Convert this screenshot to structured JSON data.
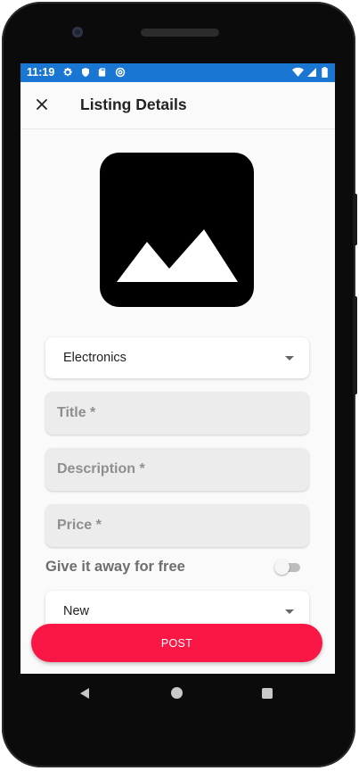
{
  "status_bar": {
    "time": "11:19",
    "left_icons": [
      "gear-icon",
      "shield-icon",
      "sd-card-icon",
      "at-sign-icon"
    ],
    "right_icons": [
      "wifi-icon",
      "signal-icon",
      "battery-icon"
    ],
    "color": "#1976d2"
  },
  "app_bar": {
    "title": "Listing Details",
    "close_icon": "close-icon"
  },
  "form": {
    "image_icon": "image-placeholder-icon",
    "category": "Electronics",
    "title_placeholder": "Title *",
    "description_placeholder": "Description *",
    "price_placeholder": "Price *",
    "free_label": "Give it away for free",
    "free_toggle_on": false,
    "condition": "New"
  },
  "actions": {
    "post_label": "POST",
    "accent": "#fa1746"
  },
  "nav_bar": {
    "icons": [
      "back-triangle-icon",
      "home-circle-icon",
      "recents-square-icon"
    ]
  }
}
